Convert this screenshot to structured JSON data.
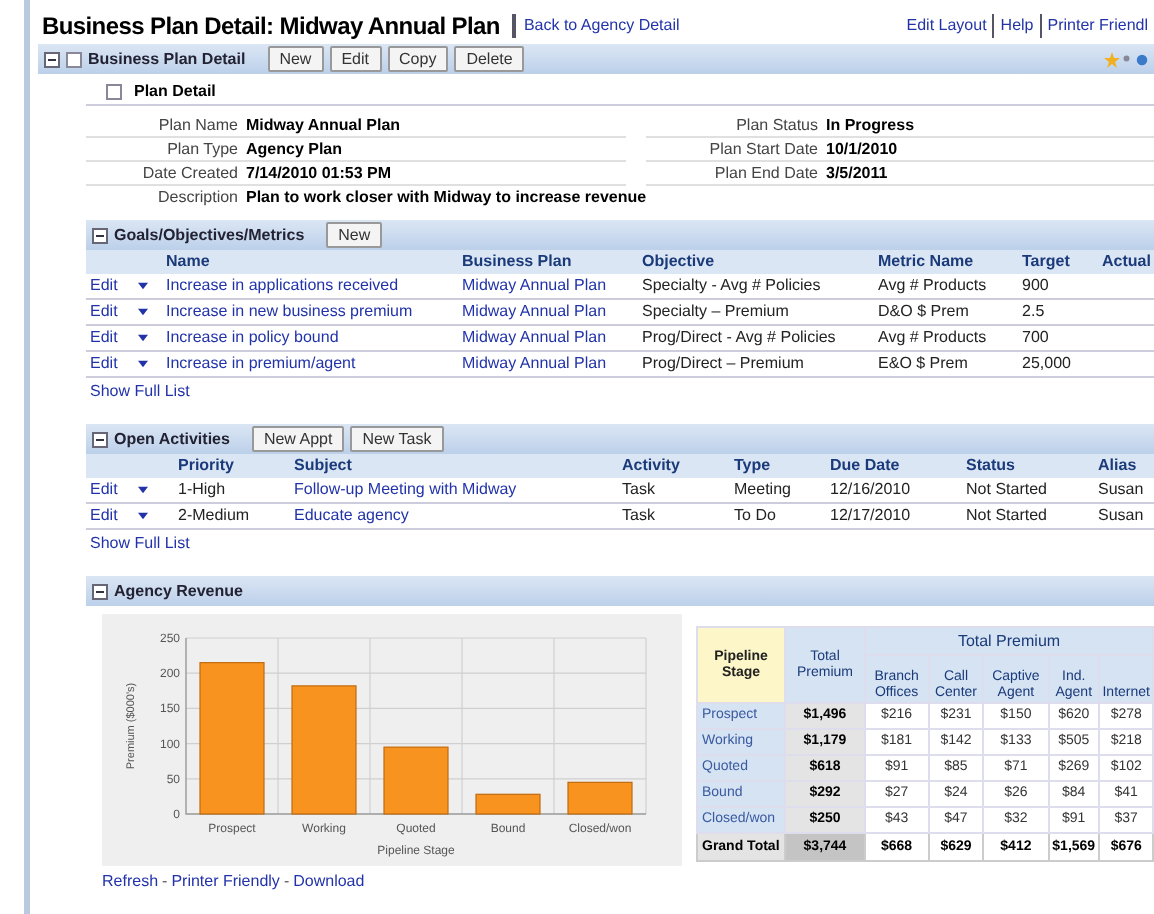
{
  "page": {
    "title": "Business Plan Detail: Midway Annual Plan",
    "back_link": "Back to Agency Detail",
    "top_links": [
      "Edit Layout",
      "Help",
      "Printer Friendl"
    ]
  },
  "business_plan": {
    "title": "Business Plan Detail",
    "buttons": [
      "New",
      "Edit",
      "Copy",
      "Delete"
    ],
    "plan_detail": {
      "title": "Plan Detail",
      "left_fields": [
        {
          "label": "Plan Name",
          "value": "Midway Annual Plan"
        },
        {
          "label": "Plan Type",
          "value": "Agency Plan"
        },
        {
          "label": "Date Created",
          "value": "7/14/2010 01:53 PM"
        }
      ],
      "right_fields": [
        {
          "label": "Plan Status",
          "value": "In Progress"
        },
        {
          "label": "Plan Start Date",
          "value": "10/1/2010"
        },
        {
          "label": "Plan End Date",
          "value": "3/5/2011"
        }
      ],
      "description": {
        "label": "Description",
        "value": "Plan to work closer with Midway to increase revenue"
      }
    }
  },
  "goals": {
    "title": "Goals/Objectives/Metrics",
    "buttons": [
      "New"
    ],
    "columns": [
      "Name",
      "Business Plan",
      "Objective",
      "Metric Name",
      "Target",
      "Actual"
    ],
    "rows": [
      {
        "action": "Edit",
        "name": "Increase in applications received",
        "plan": "Midway Annual Plan",
        "objective": "Specialty - Avg # Policies",
        "metric": "Avg # Products",
        "target": "900"
      },
      {
        "action": "Edit",
        "name": "Increase in new business premium",
        "plan": "Midway Annual Plan",
        "objective": "Specialty – Premium",
        "metric": "D&O $ Prem",
        "target": "2.5"
      },
      {
        "action": "Edit",
        "name": "Increase in policy bound",
        "plan": "Midway Annual Plan",
        "objective": "Prog/Direct - Avg # Policies",
        "metric": "Avg # Products",
        "target": "700"
      },
      {
        "action": "Edit",
        "name": "Increase in premium/agent",
        "plan": "Midway Annual Plan",
        "objective": "Prog/Direct – Premium",
        "metric": "E&O $ Prem",
        "target": "25,000"
      }
    ],
    "show_full_list": "Show Full List"
  },
  "activities": {
    "title": "Open Activities",
    "buttons": [
      "New Appt",
      "New Task"
    ],
    "columns": [
      "Priority",
      "Subject",
      "Activity",
      "Type",
      "Due Date",
      "Status",
      "Alias"
    ],
    "rows": [
      {
        "action": "Edit",
        "priority": "1-High",
        "subject": "Follow-up Meeting with Midway",
        "activity": "Task",
        "type": "Meeting",
        "due": "12/16/2010",
        "status": "Not Started",
        "alias": "Susan"
      },
      {
        "action": "Edit",
        "priority": "2-Medium",
        "subject": "Educate agency",
        "activity": "Task",
        "type": "To Do",
        "due": "12/17/2010",
        "status": "Not Started",
        "alias": "Susan"
      }
    ],
    "show_full_list": "Show Full List"
  },
  "agency_revenue": {
    "title": "Agency Revenue",
    "chart_data": {
      "type": "bar",
      "xlabel": "Pipeline Stage",
      "ylabel": "Premium ($000's)",
      "categories": [
        "Prospect",
        "Working",
        "Quoted",
        "Bound",
        "Closed/won"
      ],
      "values": [
        215,
        182,
        95,
        28,
        45
      ],
      "ylim": [
        0,
        250
      ],
      "yticks": [
        0,
        50,
        100,
        150,
        200,
        250
      ],
      "grid": true
    },
    "links": [
      "Refresh",
      "Printer Friendly",
      "Download"
    ],
    "link_separators": [
      "-",
      "-"
    ],
    "table": {
      "corner": "Pipeline Stage",
      "total_column": "Total Premium",
      "group": "Total Premium",
      "columns": [
        "Branch Offices",
        "Call Center",
        "Captive Agent",
        "Ind. Agent",
        "Internet"
      ],
      "rows": [
        {
          "stage": "Prospect",
          "total": "$1,496",
          "cells": [
            "$216",
            "$231",
            "$150",
            "$620",
            "$278"
          ]
        },
        {
          "stage": "Working",
          "total": "$1,179",
          "cells": [
            "$181",
            "$142",
            "$133",
            "$505",
            "$218"
          ]
        },
        {
          "stage": "Quoted",
          "total": "$618",
          "cells": [
            "$91",
            "$85",
            "$71",
            "$269",
            "$102"
          ]
        },
        {
          "stage": "Bound",
          "total": "$292",
          "cells": [
            "$27",
            "$24",
            "$26",
            "$84",
            "$41"
          ]
        },
        {
          "stage": "Closed/won",
          "total": "$250",
          "cells": [
            "$43",
            "$47",
            "$32",
            "$91",
            "$37"
          ]
        }
      ],
      "grand_total": {
        "label": "Grand Total",
        "total": "$3,744",
        "cells": [
          "$668",
          "$629",
          "$412",
          "$1,569",
          "$676"
        ]
      }
    }
  }
}
